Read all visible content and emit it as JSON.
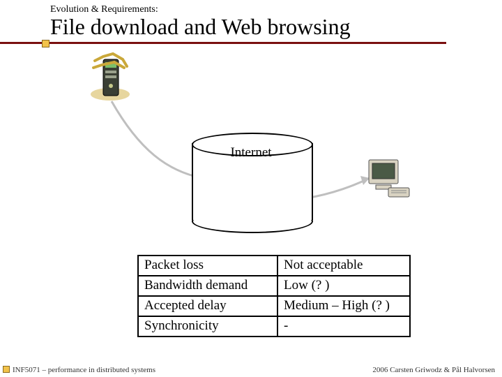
{
  "header": {
    "pretitle": "Evolution & Requirements:",
    "title": "File download and Web browsing"
  },
  "diagram": {
    "cloud_label": "Internet"
  },
  "table": {
    "rows": [
      {
        "label": "Packet loss",
        "value": "Not acceptable"
      },
      {
        "label": "Bandwidth demand",
        "value": "Low (? )"
      },
      {
        "label": "Accepted delay",
        "value": "Medium – High (? )"
      },
      {
        "label": "Synchronicity",
        "value": "-"
      }
    ]
  },
  "footer": {
    "left": "INF5071 – performance in distributed systems",
    "right": "2006 Carsten Griwodz & Pål Halvorsen"
  }
}
